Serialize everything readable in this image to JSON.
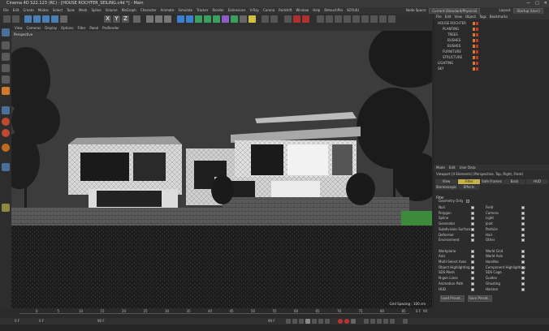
{
  "window": {
    "title": "Cinema 4D S22.123 (RC) - [HOUSE ROCHTER_SEILING.c4d *] - Main",
    "controls": [
      "—",
      "□",
      "✕"
    ]
  },
  "menubar": {
    "items": [
      "File",
      "Edit",
      "Create",
      "Modes",
      "Select",
      "Tools",
      "Mesh",
      "Spline",
      "Volume",
      "MoGraph",
      "Character",
      "Animate",
      "Simulate",
      "Tracker",
      "Render",
      "Extensions",
      "V-Ray",
      "Corona",
      "Redshift",
      "Window",
      "Help",
      "RetouchPro",
      "SOTs4U"
    ],
    "node_space_label": "Node Space:",
    "node_space_value": "Current (Standard/Physical)",
    "layout_label": "Layout:",
    "layout_value": "Startup (User)"
  },
  "toolbar": {
    "axis_buttons": [
      "X",
      "Y",
      "Z"
    ]
  },
  "viewport": {
    "menu": [
      "View",
      "Cameras",
      "Display",
      "Options",
      "Filter",
      "Panel",
      "ProRender"
    ],
    "label": "Perspective",
    "grid_spacing": "Grid Spacing : 100 cm"
  },
  "object_manager": {
    "menu": [
      "File",
      "Edit",
      "View",
      "Object",
      "Tags",
      "Bookmarks"
    ],
    "objects": [
      {
        "name": "HOUSE ROCHTER",
        "indent": 0
      },
      {
        "name": "PLANTING",
        "indent": 1
      },
      {
        "name": "TREES",
        "indent": 2
      },
      {
        "name": "BUSHES",
        "indent": 2
      },
      {
        "name": "BUSHES",
        "indent": 2
      },
      {
        "name": "FURNITURE",
        "indent": 1
      },
      {
        "name": "STRUCTURE",
        "indent": 1
      },
      {
        "name": "LIGHTING",
        "indent": 0
      },
      {
        "name": "SKY",
        "indent": 0
      }
    ]
  },
  "attributes": {
    "menu": [
      "Mode",
      "Edit",
      "User Data"
    ],
    "title": "Viewport [4 Elements] (Perspective, Top, Right, Front)",
    "tabs": [
      "View",
      "Filter",
      "Safe Frames",
      "Back",
      "HUD",
      "Stereoscopic",
      "Effects"
    ],
    "active_tab": "Filter",
    "section": "Filter",
    "geometry_only": "Geometry Only",
    "left_options": [
      {
        "label": "Null",
        "on": true
      },
      {
        "label": "Polygon",
        "on": true
      },
      {
        "label": "Spline",
        "on": true
      },
      {
        "label": "Generator",
        "on": true
      },
      {
        "label": "Subdivision Surface",
        "on": true
      },
      {
        "label": "Deformer",
        "on": true
      },
      {
        "label": "Environment",
        "on": true
      },
      {
        "label": "",
        "on": null
      },
      {
        "label": "Workplane",
        "on": true
      },
      {
        "label": "Axis",
        "on": true
      },
      {
        "label": "Multi-Select Axes",
        "on": true
      },
      {
        "label": "Object Highlighting",
        "on": true
      },
      {
        "label": "SDS Mesh",
        "on": true
      },
      {
        "label": "N-gon Lines",
        "on": true
      },
      {
        "label": "Animation Path",
        "on": true
      },
      {
        "label": "HUD",
        "on": true
      }
    ],
    "right_options": [
      {
        "label": "Field",
        "on": true
      },
      {
        "label": "Camera",
        "on": true
      },
      {
        "label": "Light",
        "on": true
      },
      {
        "label": "Joint",
        "on": true
      },
      {
        "label": "Particle",
        "on": true
      },
      {
        "label": "Hair",
        "on": true
      },
      {
        "label": "Other",
        "on": true
      },
      {
        "label": "",
        "on": null
      },
      {
        "label": "World Grid",
        "on": true
      },
      {
        "label": "World Axis",
        "on": true
      },
      {
        "label": "Handles",
        "on": true
      },
      {
        "label": "Component Highlighting",
        "on": true
      },
      {
        "label": "SDS Cage",
        "on": true
      },
      {
        "label": "Guides",
        "on": true
      },
      {
        "label": "Ghosting",
        "on": true
      },
      {
        "label": "Horizon",
        "on": true
      }
    ],
    "buttons": [
      "Load Preset...",
      "Save Preset..."
    ]
  },
  "timeline": {
    "ticks": [
      "0",
      "5",
      "10",
      "15",
      "20",
      "25",
      "30",
      "35",
      "40",
      "45",
      "50",
      "55",
      "60",
      "65",
      "70",
      "75",
      "80",
      "85",
      "90"
    ],
    "end_frame": "0 F"
  },
  "transport": {
    "start": "0 F",
    "min": "0 F",
    "max": "90 F",
    "end": "90 F"
  },
  "colors": {
    "accent": "#c8b14a",
    "tag_orange": "#d9792b",
    "tag_red": "#c0392b"
  }
}
